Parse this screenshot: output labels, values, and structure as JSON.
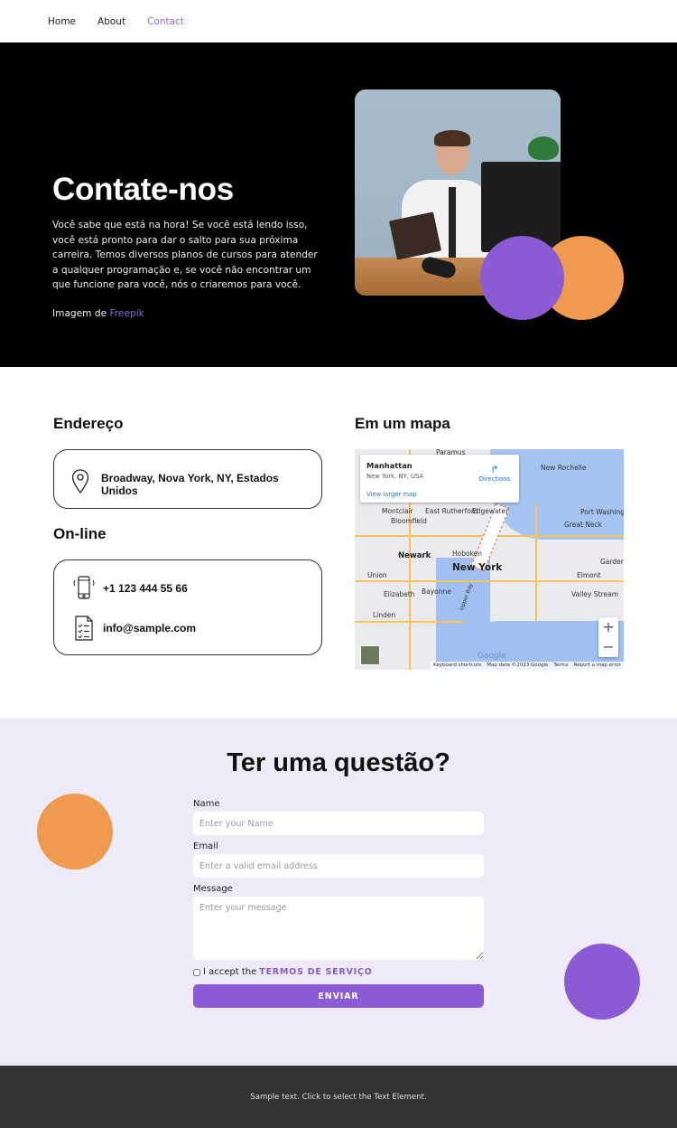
{
  "nav": {
    "items": [
      {
        "label": "Home",
        "active": false
      },
      {
        "label": "About",
        "active": false
      },
      {
        "label": "Contact",
        "active": true
      }
    ]
  },
  "hero": {
    "title": "Contate-nos",
    "lead": "Você sabe que está na hora! Se você está lendo isso, você está pronto para dar o salto para sua próxima carreira. Temos diversos planos de cursos para atender a qualquer programação e, se você não encontrar um que funcione para você, nós o criaremos para você.",
    "credit_prefix": "Imagem de ",
    "credit_link": "Freepik"
  },
  "address": {
    "heading": "Endereço",
    "value": "Broadway, Nova York, NY, Estados Unidos"
  },
  "online": {
    "heading": "On-line",
    "phone": "+1 123 444 55 66",
    "email": "info@sample.com"
  },
  "map": {
    "heading": "Em um mapa",
    "card_title": "Manhattan",
    "card_subtitle": "New York, NY, USA",
    "directions": "Directions",
    "larger_map": "View larger map",
    "zoom_in": "+",
    "zoom_out": "−",
    "google_logo": "Google",
    "attribution": [
      "Keyboard shortcuts",
      "Map data ©2023 Google",
      "Terms",
      "Report a map error"
    ],
    "labels": [
      "Paramus",
      "New Rochelle",
      "Montclair",
      "East Rutherford",
      "Edgewater",
      "Bloomfield",
      "Great Neck",
      "Port Washington",
      "Newark",
      "Hoboken",
      "New York",
      "Garden City",
      "Union",
      "Elmont",
      "Elizabeth",
      "Bayonne",
      "Valley Stream",
      "Linden",
      "Upper Bay"
    ]
  },
  "form": {
    "heading": "Ter uma questão?",
    "name_label": "Name",
    "name_placeholder": "Enter your Name",
    "email_label": "Email",
    "email_placeholder": "Enter a valid email address",
    "message_label": "Message",
    "message_placeholder": "Enter your message",
    "accept_prefix": "I accept the",
    "terms_link": "TERMOS DE SERVIÇO",
    "submit": "ENVIAR"
  },
  "footer": {
    "text": "Sample text. Click to select the Text Element."
  },
  "colors": {
    "accent_purple": "#8b5bd6",
    "accent_orange": "#ef9a4f",
    "link_purple": "#8a6ad0",
    "form_bg": "#efeaf8",
    "footer_bg": "#333333"
  }
}
